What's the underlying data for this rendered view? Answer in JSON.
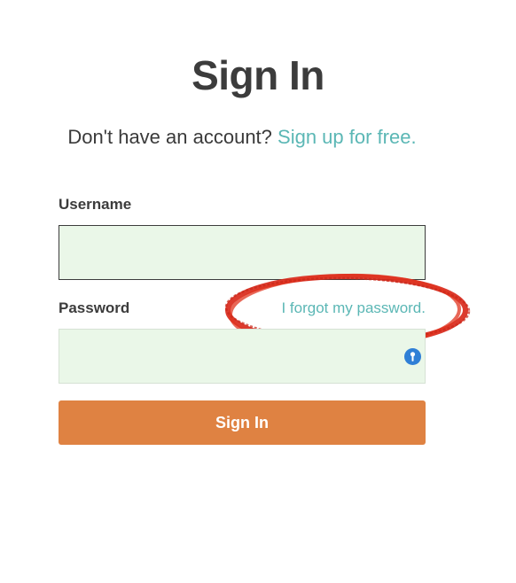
{
  "page": {
    "title": "Sign In"
  },
  "signup": {
    "prompt": "Don't have an account?",
    "link": "Sign up for free."
  },
  "form": {
    "username_label": "Username",
    "username_value": "",
    "password_label": "Password",
    "password_value": "",
    "forgot_link": "I forgot my password.",
    "submit_label": "Sign In"
  },
  "icons": {
    "password_manager": "key-icon",
    "annotation": "red-circle-annotation"
  },
  "colors": {
    "link": "#5bb7b5",
    "input_background": "#eaf7e8",
    "button": "#df8242",
    "annotation": "#d92a1c",
    "icon": "#2f7fd6"
  }
}
